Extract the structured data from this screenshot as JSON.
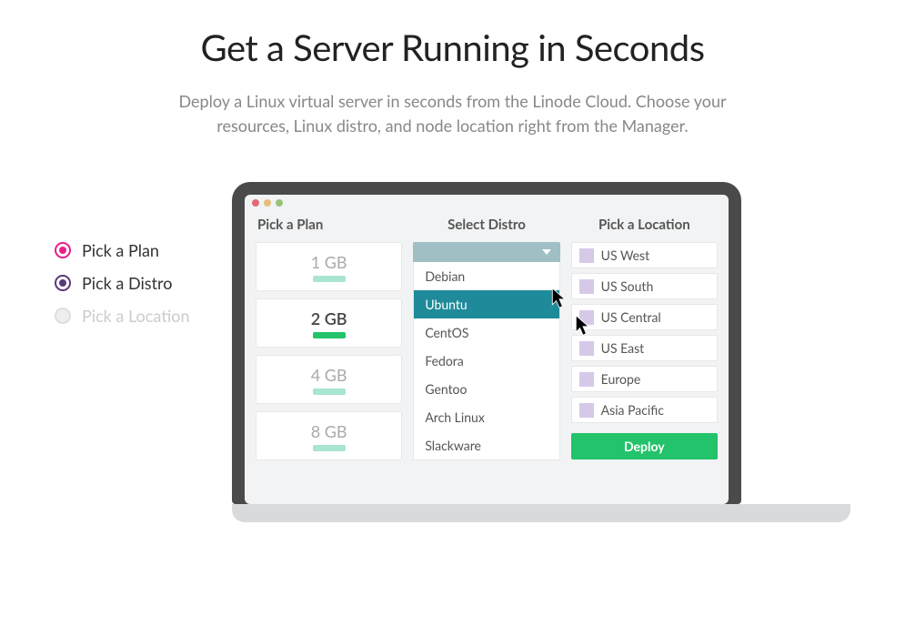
{
  "hero": {
    "title": "Get a Server Running in Seconds",
    "subtitle": "Deploy a Linux virtual server in seconds from the Linode Cloud. Choose your resources, Linux distro, and node location right from the Manager."
  },
  "steps": {
    "plan": "Pick a Plan",
    "distro": "Pick a Distro",
    "location": "Pick a Location"
  },
  "columns": {
    "plan_title": "Pick a Plan",
    "distro_title": "Select Distro",
    "location_title": "Pick a Location"
  },
  "plans": [
    {
      "label": "1 GB",
      "active": false
    },
    {
      "label": "2 GB",
      "active": true
    },
    {
      "label": "4 GB",
      "active": false
    },
    {
      "label": "8 GB",
      "active": false
    }
  ],
  "distros": [
    {
      "label": "Debian",
      "selected": false
    },
    {
      "label": "Ubuntu",
      "selected": true
    },
    {
      "label": "CentOS",
      "selected": false
    },
    {
      "label": "Fedora",
      "selected": false
    },
    {
      "label": "Gentoo",
      "selected": false
    },
    {
      "label": "Arch Linux",
      "selected": false
    },
    {
      "label": "Slackware",
      "selected": false
    }
  ],
  "locations": [
    {
      "label": "US West"
    },
    {
      "label": "US South"
    },
    {
      "label": "US Central"
    },
    {
      "label": "US East"
    },
    {
      "label": "Europe"
    },
    {
      "label": "Asia Pacific"
    }
  ],
  "deploy_label": "Deploy"
}
